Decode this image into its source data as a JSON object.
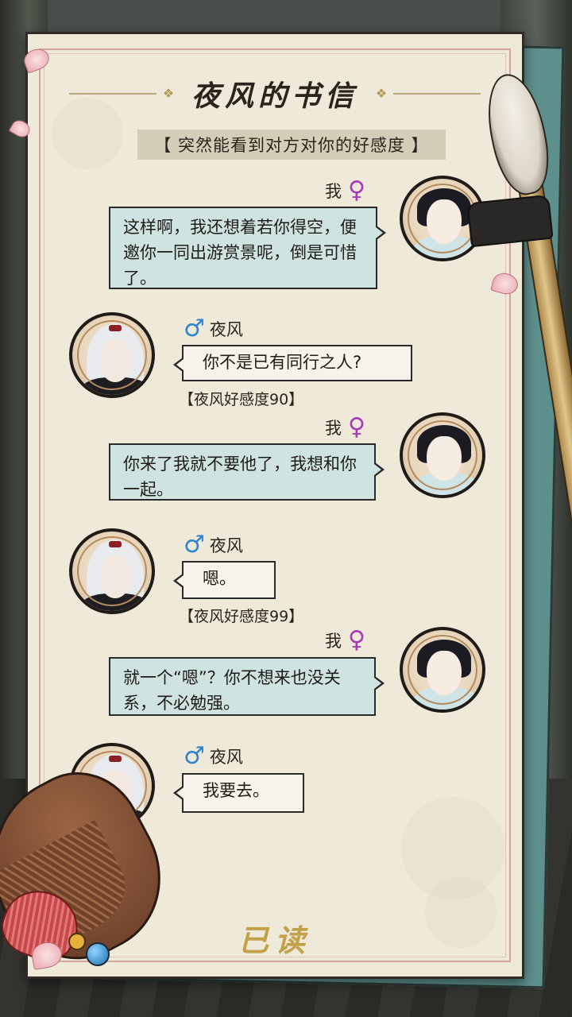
{
  "letter": {
    "title": "夜风的书信",
    "subtitle": "【 突然能看到对方对你的好感度 】",
    "read_status": "已读"
  },
  "messages": [
    {
      "sender": "me",
      "name": "我",
      "gender_symbol": "♀",
      "text": "这样啊，我还想着若你得空，便邀你一同出游赏景呢，倒是可惜了。"
    },
    {
      "sender": "yefeng",
      "name": "夜风",
      "gender_symbol": "♂",
      "text": "你不是已有同行之人?",
      "affection": "【夜风好感度90】"
    },
    {
      "sender": "me",
      "name": "我",
      "gender_symbol": "♀",
      "text": "你来了我就不要他了，我想和你一起。"
    },
    {
      "sender": "yefeng",
      "name": "夜风",
      "gender_symbol": "♂",
      "text": "嗯。",
      "affection": "【夜风好感度99】"
    },
    {
      "sender": "me",
      "name": "我",
      "gender_symbol": "♀",
      "text": "就一个“嗯”？你不想来也没关系，不必勉强。"
    },
    {
      "sender": "yefeng",
      "name": "夜风",
      "gender_symbol": "♂",
      "text": "我要去。"
    }
  ],
  "colors": {
    "paper": "#efe9da",
    "my_bubble": "#cfe3e1",
    "his_bubble": "#f7f3ea",
    "female_symbol": "#a83ab6",
    "male_symbol": "#2d86c9",
    "read_stamp": "#c2a14a"
  },
  "icons": [
    "female-symbol-icon",
    "male-symbol-icon",
    "brush-icon",
    "comb-icon"
  ]
}
